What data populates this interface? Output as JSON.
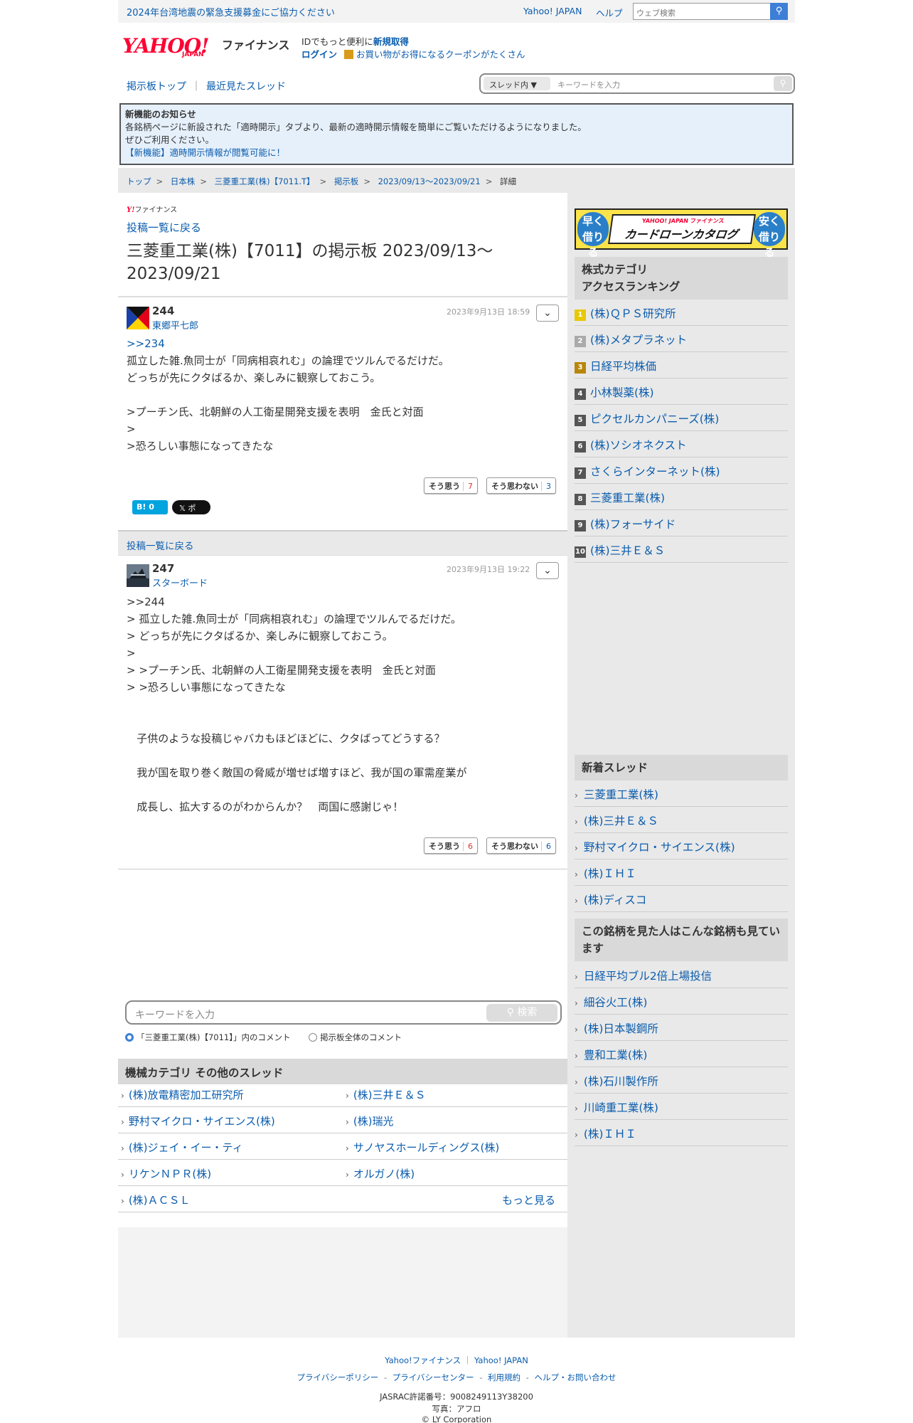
{
  "topbar": {
    "notice": "2024年台湾地震の緊急支援募金にご協力ください",
    "yahoo_japan": "Yahoo! JAPAN",
    "help": "ヘルプ",
    "search_placeholder": "ウェブ検索"
  },
  "header": {
    "logo_text": "YAHOO!",
    "logo_sub": "JAPAN",
    "finance": "ファイナンス",
    "id_prefix": "IDでもっと便利に",
    "id_link": "新規取得",
    "login": "ログイン",
    "coupon_text": "お買い物がお得になるクーポンがたくさん"
  },
  "nav": {
    "board_top": "掲示板トップ",
    "recent": "最近見たスレッド",
    "sep": "｜",
    "scope": "スレッド内",
    "keyword_placeholder": "キーワードを入力"
  },
  "info": {
    "title": "新機能のお知らせ",
    "line1": "各銘柄ページに新設された「適時開示」タブより、最新の適時開示情報を簡単にご覧いただけるようになりました。",
    "line2": "ぜひご利用ください。",
    "link": "【新機能】適時開示情報が閲覧可能に！"
  },
  "breadcrumb": {
    "items": [
      "トップ",
      "日本株",
      "三菱重工業(株)【7011.T】",
      "掲示板",
      "2023/09/13〜2023/09/21"
    ],
    "current": "詳細",
    "sep": ">"
  },
  "page": {
    "small_logo": "ファイナンス",
    "small_logo_y": "Y!",
    "back": "投稿一覧に戻る",
    "title": "三菱重工業(株)【7011】の掲示板 2023/09/13〜2023/09/21"
  },
  "posts": [
    {
      "number": "244",
      "author": "東郷平七郎",
      "date": "2023年9月13日 18:59",
      "reply": ">>234",
      "body": "孤立した雑.魚同士が「同病相哀れむ」の論理でツルんでるだけだ。\nどっちが先にクタばるか、楽しみに観察しておこう。\n\n>プーチン氏、北朝鮮の人工衛星開発支援を表明　金氏と対面\n>\n>恐ろしい事態になってきたな",
      "agree_label": "そう思う",
      "agree": "7",
      "disagree_label": "そう思わない",
      "disagree": "3"
    },
    {
      "number": "247",
      "author": "スターボード",
      "date": "2023年9月13日 19:22",
      "reply": "",
      "body": ">>244\n> 孤立した雑.魚同士が「同病相哀れむ」の論理でツルんでるだけだ。\n> どっちが先にクタばるか、楽しみに観察しておこう。\n>\n> >プーチン氏、北朝鮮の人工衛星開発支援を表明　金氏と対面\n> >恐ろしい事態になってきたな\n\n\n   子供のような投稿じゃバカもほどほどに、クタばってどうする？\n\n   我が国を取り巻く敵国の脅威が増せば増すほど、我が国の軍需産業が\n\n   成長し、拡大するのがわからんか？　両国に感謝じゃ！",
      "agree_label": "そう思う",
      "agree": "6",
      "disagree_label": "そう思わない",
      "disagree": "6"
    }
  ],
  "share": {
    "hatena": "B! 0",
    "x": "𝕏 ポスト"
  },
  "back_bar": "投稿一覧に戻る",
  "bottom_search": {
    "placeholder": "キーワードを入力",
    "button": "検索",
    "radio1": "「三菱重工業(株)【7011】」内のコメント",
    "radio2": "掲示板全体のコメント"
  },
  "other_threads": {
    "title": "機械カテゴリ その他のスレッド",
    "items": [
      "(株)放電精密加工研究所",
      "(株)三井Ｅ＆Ｓ",
      "野村マイクロ・サイエンス(株)",
      "(株)瑞光",
      "(株)ジェイ・イー・ティ",
      "サノヤスホールディングス(株)",
      "リケンＮＰＲ(株)",
      "オルガノ(株)",
      "(株)ＡＣＳＬ"
    ],
    "more": "もっと見る"
  },
  "ad": {
    "left": "早く借りる",
    "right": "安く借りる",
    "brand": "YAHOO! JAPAN ファイナンス",
    "title": "カードローンカタログ"
  },
  "ranking": {
    "title": "株式カテゴリ\nアクセスランキング",
    "items": [
      "(株)ＱＰＳ研究所",
      "(株)メタプラネット",
      "日経平均株価",
      "小林製薬(株)",
      "ピクセルカンパニーズ(株)",
      "(株)ソシオネクスト",
      "さくらインターネット(株)",
      "三菱重工業(株)",
      "(株)フォーサイド",
      "(株)三井Ｅ＆Ｓ"
    ]
  },
  "new_threads": {
    "title": "新着スレッド",
    "items": [
      "三菱重工業(株)",
      "(株)三井Ｅ＆Ｓ",
      "野村マイクロ・サイエンス(株)",
      "(株)ＩＨＩ",
      "(株)ディスコ"
    ]
  },
  "also_viewed": {
    "title": "この銘柄を見た人はこんな銘柄も見ています",
    "items": [
      "日経平均ブル2倍上場投信",
      "細谷火工(株)",
      "(株)日本製鋼所",
      "豊和工業(株)",
      "(株)石川製作所",
      "川崎重工業(株)",
      "(株)ＩＨＩ"
    ]
  },
  "footer": {
    "finance": "Yahoo!ファイナンス",
    "yj": "Yahoo! JAPAN",
    "sep": "｜",
    "privacy": "プライバシーポリシー",
    "privacy_center": "プライバシーセンター",
    "terms": "利用規約",
    "help": "ヘルプ・お問い合わせ",
    "dash": "-",
    "jasrac": "JASRAC許諾番号：9008249113Y38200",
    "photo": "写真：アフロ",
    "copyright": "© LY Corporation"
  }
}
